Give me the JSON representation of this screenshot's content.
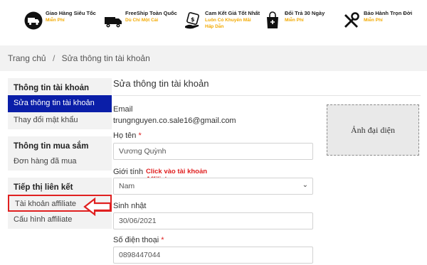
{
  "benefits": [
    {
      "icon": "delivery-truck-icon",
      "title": "Giao Hàng Siêu Tốc",
      "subtitle": "Miễn Phí"
    },
    {
      "icon": "free-ship-truck-icon",
      "title": "FreeShip Toàn Quốc",
      "subtitle": "Dù Chỉ Một Cái"
    },
    {
      "icon": "price-commitment-icon",
      "title": "Cam Kết Giá Tốt Nhất",
      "subtitle": "Luôn Có Khuyến Mãi",
      "subtitle2": "Hấp Dẫn"
    },
    {
      "icon": "return-bag-icon",
      "title": "Đổi Trả 30 Ngày",
      "subtitle": "Miễn Phí"
    },
    {
      "icon": "tools-warranty-icon",
      "title": "Bảo Hành Trọn Đời",
      "subtitle": "Miễn Phí"
    }
  ],
  "breadcrumb": {
    "home": "Trang chủ",
    "separator": "/",
    "current": "Sửa thông tin tài khoản"
  },
  "sidebar": {
    "groups": [
      {
        "heading": "Thông tin tài khoản",
        "items": [
          {
            "label": "Sửa thông tin tài khoản",
            "active": true
          },
          {
            "label": "Thay đổi mật khẩu"
          }
        ]
      },
      {
        "heading": "Thông tin mua sắm",
        "items": [
          {
            "label": "Đơn hàng đã mua"
          }
        ]
      },
      {
        "heading": "Tiếp thị liên kết",
        "items": [
          {
            "label": "Tài khoản affiliate",
            "highlighted": true
          },
          {
            "label": "Cấu hình affiliate"
          }
        ]
      }
    ]
  },
  "annotation": {
    "text": "Click vào tài khoản Affiliate",
    "color": "#e02020"
  },
  "form": {
    "title": "Sửa thông tin tài khoản",
    "email_label": "Email",
    "email_value": "trungnguyen.co.sale16@gmail.com",
    "name_label": "Họ tên",
    "name_value": "Vương Quỳnh",
    "gender_label": "Giới tính",
    "gender_value": "Nam",
    "birthday_label": "Sinh nhật",
    "birthday_value": "30/06/2021",
    "phone_label": "Số điện thoại",
    "phone_value": "0898447044",
    "required_mark": "*"
  },
  "avatar": {
    "label": "Ảnh đại diện"
  },
  "colors": {
    "accent": "#0a1ea8",
    "highlight": "#e02020",
    "benefit_sub": "#f2a900"
  }
}
